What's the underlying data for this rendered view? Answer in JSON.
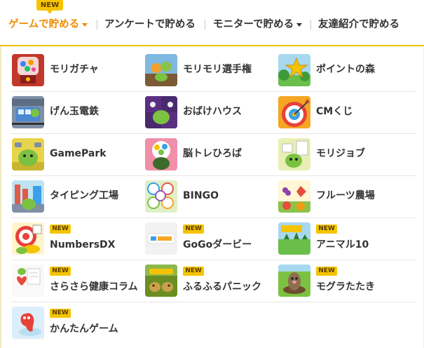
{
  "nav": {
    "new_badge": "NEW",
    "items": [
      {
        "label": "ゲームで貯める",
        "has_caret": true,
        "active": true
      },
      {
        "label": "アンケートで貯める",
        "has_caret": false,
        "active": false
      },
      {
        "label": "モニターで貯める",
        "has_caret": true,
        "active": false
      },
      {
        "label": "友達紹介で貯める",
        "has_caret": false,
        "active": false
      }
    ]
  },
  "games": [
    {
      "label": "モリガチャ",
      "new": false,
      "icon": "gacha-machine-icon"
    },
    {
      "label": "モリモリ選手権",
      "new": false,
      "icon": "championship-icon"
    },
    {
      "label": "ポイントの森",
      "new": false,
      "icon": "star-forest-icon"
    },
    {
      "label": "げん玉電鉄",
      "new": false,
      "icon": "train-icon"
    },
    {
      "label": "おばけハウス",
      "new": false,
      "icon": "ghost-house-icon"
    },
    {
      "label": "CMくじ",
      "new": false,
      "icon": "target-arrow-icon"
    },
    {
      "label": "GamePark",
      "new": false,
      "icon": "gamepark-icon"
    },
    {
      "label": "脳トレひろば",
      "new": false,
      "icon": "brain-icon"
    },
    {
      "label": "モリジョブ",
      "new": false,
      "icon": "job-icon"
    },
    {
      "label": "タイピング工場",
      "new": false,
      "icon": "factory-icon"
    },
    {
      "label": "BINGO",
      "new": false,
      "icon": "bingo-balls-icon"
    },
    {
      "label": "フルーツ農場",
      "new": false,
      "icon": "fruit-icon"
    },
    {
      "label": "NumbersDX",
      "new": true,
      "icon": "dartboard-icon"
    },
    {
      "label": "GoGoダービー",
      "new": true,
      "icon": "derby-icon"
    },
    {
      "label": "アニマル10",
      "new": true,
      "icon": "animal-field-icon"
    },
    {
      "label": "さらさら健康コラム",
      "new": true,
      "icon": "health-column-icon"
    },
    {
      "label": "ふるふるパニック",
      "new": true,
      "icon": "panic-icon"
    },
    {
      "label": "モグラたたき",
      "new": true,
      "icon": "mole-icon"
    },
    {
      "label": "かんたんゲーム",
      "new": true,
      "icon": "easy-game-icon"
    }
  ],
  "new_label": "NEW",
  "colors": {
    "accent": "#f08c00",
    "badge": "#f5c400"
  }
}
